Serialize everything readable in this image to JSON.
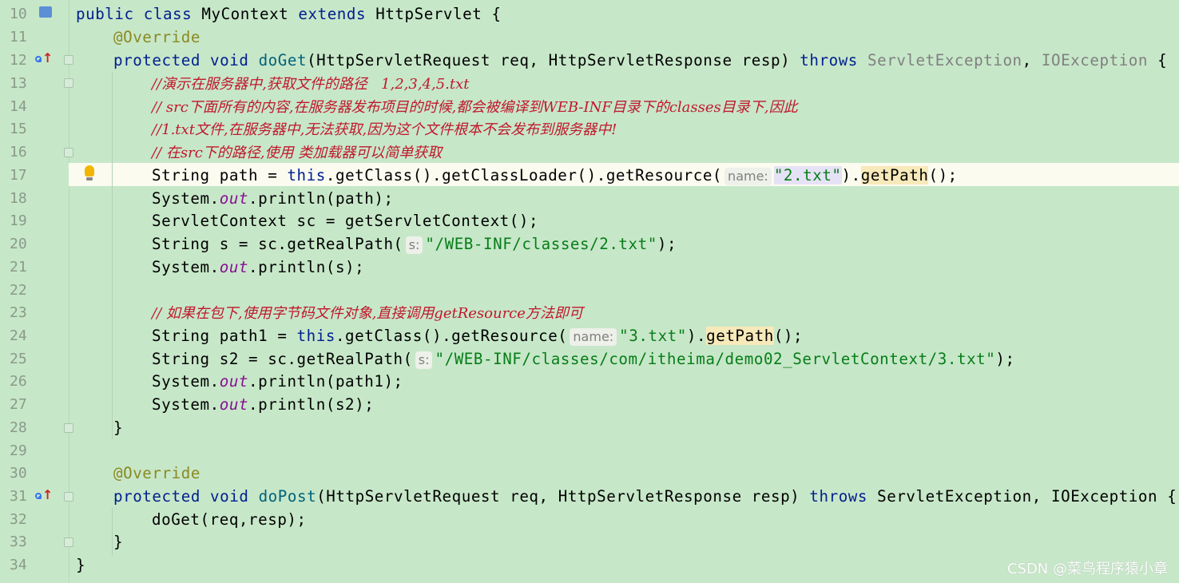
{
  "lines": [
    {
      "n": "10"
    },
    {
      "n": "11"
    },
    {
      "n": "12"
    },
    {
      "n": "13"
    },
    {
      "n": "14"
    },
    {
      "n": "15"
    },
    {
      "n": "16"
    },
    {
      "n": "17"
    },
    {
      "n": "18"
    },
    {
      "n": "19"
    },
    {
      "n": "20"
    },
    {
      "n": "21"
    },
    {
      "n": "22"
    },
    {
      "n": "23"
    },
    {
      "n": "24"
    },
    {
      "n": "25"
    },
    {
      "n": "26"
    },
    {
      "n": "27"
    },
    {
      "n": "28"
    },
    {
      "n": "29"
    },
    {
      "n": "30"
    },
    {
      "n": "31"
    },
    {
      "n": "32"
    },
    {
      "n": "33"
    },
    {
      "n": "34"
    }
  ],
  "code": {
    "l10": {
      "kw1": "public",
      "kw2": "class",
      "name": "MyContext",
      "kw3": "extends",
      "sup": "HttpServlet",
      "brace": " {"
    },
    "l11": {
      "ann": "@Override"
    },
    "l12": {
      "kw1": "protected",
      "kw2": "void",
      "fn": "doGet",
      "p1": "(HttpServletRequest req, HttpServletResponse resp) ",
      "kw3": "throws",
      "ex1": "ServletException",
      "sep": ", ",
      "ex2": "IOException",
      "brace": " {"
    },
    "l13": {
      "cmt": "//演示在服务器中,获取文件的路径   1,2,3,4,5.txt"
    },
    "l14": {
      "cmt": "// src下面所有的内容,在服务器发布项目的时候,都会被编译到WEB-INF目录下的classes目录下,因此"
    },
    "l15": {
      "cmt": "//1.txt文件,在服务器中,无法获取,因为这个文件根本不会发布到服务器中!"
    },
    "l16": {
      "cmt": "// 在src下的路径,使用 类加载器可以简单获取"
    },
    "l17": {
      "a": "String path = ",
      "kw": "this",
      "b": ".getClass().getClassLoader().getResource(",
      "hint": "name:",
      "str": "\"2.txt\"",
      "c": ").",
      "fn": "getPath",
      "d": "();"
    },
    "l18": {
      "a": "System.",
      "fld": "out",
      "b": ".println(path);"
    },
    "l19": {
      "a": "ServletContext sc = getServletContext();"
    },
    "l20": {
      "a": "String s = sc.getRealPath(",
      "hint": "s:",
      "str": "\"/WEB-INF/classes/2.txt\"",
      "b": ");"
    },
    "l21": {
      "a": "System.",
      "fld": "out",
      "b": ".println(s);"
    },
    "l23": {
      "cmt": "// 如果在包下,使用字节码文件对象,直接调用getResource方法即可"
    },
    "l24": {
      "a": "String path1 = ",
      "kw": "this",
      "b": ".getClass().getResource(",
      "hint": "name:",
      "str": "\"3.txt\"",
      "c": ").",
      "fn": "getPath",
      "d": "();"
    },
    "l25": {
      "a": "String s2 = sc.getRealPath(",
      "hint": "s:",
      "str": "\"/WEB-INF/classes/com/itheima/demo02_ServletContext/3.txt\"",
      "b": ");"
    },
    "l26": {
      "a": "System.",
      "fld": "out",
      "b": ".println(path1);"
    },
    "l27": {
      "a": "System.",
      "fld": "out",
      "b": ".println(s2);"
    },
    "l28": {
      "a": "}"
    },
    "l30": {
      "ann": "@Override"
    },
    "l31": {
      "kw1": "protected",
      "kw2": "void",
      "fn": "doPost",
      "p1": "(HttpServletRequest req, HttpServletResponse resp) ",
      "kw3": "throws",
      "ex1": "ServletException",
      "sep": ", ",
      "ex2": "IOException",
      "brace": " {"
    },
    "l32": {
      "a": "doGet(req,resp);"
    },
    "l33": {
      "a": "}"
    },
    "l34": {
      "a": "}"
    }
  },
  "gutter_icons": {
    "class_icon": "class-gutter-icon",
    "override_icon": "overrides-method-icon",
    "bulb_icon": "lightbulb-icon",
    "fold_icon": "fold-marker-icon"
  },
  "watermark": "CSDN @菜鸟程序猿小章",
  "colors": {
    "background": "#c7e7c9",
    "keyword": "#00208f",
    "string": "#067d17",
    "comment": "#c0182c",
    "annotation": "#8a8a20",
    "current_line": "#fbfbf0"
  }
}
